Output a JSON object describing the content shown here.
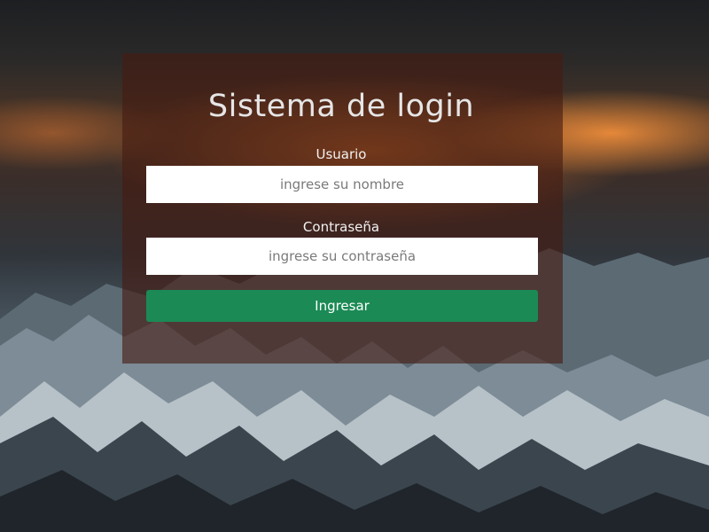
{
  "login": {
    "title": "Sistema de login",
    "username_label": "Usuario",
    "username_placeholder": "ingrese su nombre",
    "username_value": "",
    "password_label": "Contraseña",
    "password_placeholder": "ingrese su contraseña",
    "password_value": "",
    "submit_label": "Ingresar"
  },
  "colors": {
    "panel_overlay": "#461c12",
    "button": "#1b8a55",
    "title_text": "#e6e6e6"
  }
}
